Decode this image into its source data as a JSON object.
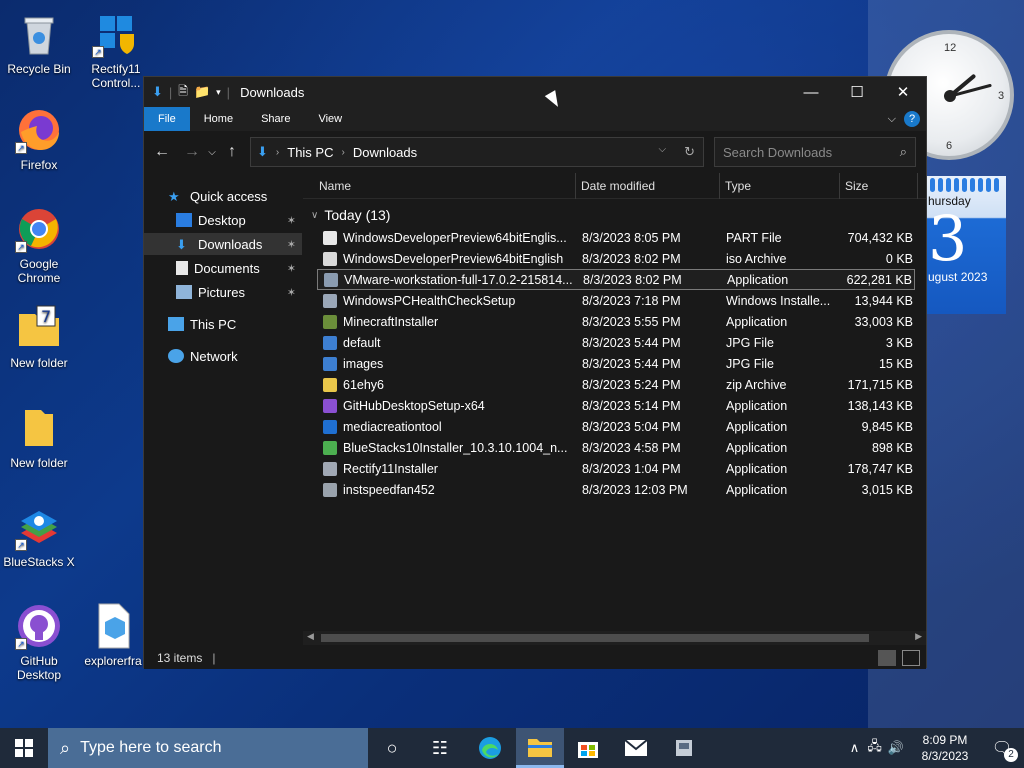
{
  "desktop": {
    "icons": [
      {
        "label": "Recycle Bin"
      },
      {
        "label": "Rectify11 Control..."
      },
      {
        "label": "Firefox"
      },
      {
        "label": "Google Chrome"
      },
      {
        "label": "New folder"
      },
      {
        "label": "New folder"
      },
      {
        "label": "BlueStacks X"
      },
      {
        "label": "GitHub Desktop"
      },
      {
        "label": "explorerfra"
      }
    ],
    "clock_numbers": [
      "12",
      "3",
      "6"
    ],
    "calendar": {
      "day_name": "hursday",
      "day_number": "3",
      "month": "ugust 2023"
    }
  },
  "window": {
    "title": "Downloads",
    "ribbon_tabs": [
      "File",
      "Home",
      "Share",
      "View"
    ],
    "help_label": "?",
    "address": {
      "root": "This PC",
      "current": "Downloads"
    },
    "search_placeholder": "Search Downloads",
    "nav": {
      "quick_access": "Quick access",
      "desktop": "Desktop",
      "downloads": "Downloads",
      "documents": "Documents",
      "pictures": "Pictures",
      "this_pc": "This PC",
      "network": "Network"
    },
    "columns": {
      "name": "Name",
      "date": "Date modified",
      "type": "Type",
      "size": "Size"
    },
    "group_label": "Today (13)",
    "files": [
      {
        "name": "WindowsDeveloperPreview64bitEnglis...",
        "date": "8/3/2023 8:05 PM",
        "type": "PART File",
        "size": "704,432 KB",
        "icon_color": "#e8e8e8"
      },
      {
        "name": "WindowsDeveloperPreview64bitEnglish",
        "date": "8/3/2023 8:02 PM",
        "type": "iso Archive",
        "size": "0 KB",
        "icon_color": "#d9d9d9"
      },
      {
        "name": "VMware-workstation-full-17.0.2-215814...",
        "date": "8/3/2023 8:02 PM",
        "type": "Application",
        "size": "622,281 KB",
        "icon_color": "#8a9bb0"
      },
      {
        "name": "WindowsPCHealthCheckSetup",
        "date": "8/3/2023 7:18 PM",
        "type": "Windows Installe...",
        "size": "13,944 KB",
        "icon_color": "#9aa7b8"
      },
      {
        "name": "MinecraftInstaller",
        "date": "8/3/2023 5:55 PM",
        "type": "Application",
        "size": "33,003 KB",
        "icon_color": "#6b8e3a"
      },
      {
        "name": "default",
        "date": "8/3/2023 5:44 PM",
        "type": "JPG File",
        "size": "3 KB",
        "icon_color": "#3d7fd1"
      },
      {
        "name": "images",
        "date": "8/3/2023 5:44 PM",
        "type": "JPG File",
        "size": "15 KB",
        "icon_color": "#3d7fd1"
      },
      {
        "name": "61ehy6",
        "date": "8/3/2023 5:24 PM",
        "type": "zip Archive",
        "size": "171,715 KB",
        "icon_color": "#e8c64a"
      },
      {
        "name": "GitHubDesktopSetup-x64",
        "date": "8/3/2023 5:14 PM",
        "type": "Application",
        "size": "138,143 KB",
        "icon_color": "#8a4fd1"
      },
      {
        "name": "mediacreationtool",
        "date": "8/3/2023 5:04 PM",
        "type": "Application",
        "size": "9,845 KB",
        "icon_color": "#1f6fd1"
      },
      {
        "name": "BlueStacks10Installer_10.3.10.1004_n...",
        "date": "8/3/2023 4:58 PM",
        "type": "Application",
        "size": "898 KB",
        "icon_color": "#4caf50"
      },
      {
        "name": "Rectify11Installer",
        "date": "8/3/2023 1:04 PM",
        "type": "Application",
        "size": "178,747 KB",
        "icon_color": "#a0a8b4"
      },
      {
        "name": "instspeedfan452",
        "date": "8/3/2023 12:03 PM",
        "type": "Application",
        "size": "3,015 KB",
        "icon_color": "#9aa3ad"
      }
    ],
    "status_text": "13 items"
  },
  "taskbar": {
    "search_placeholder": "Type here to search",
    "time": "8:09 PM",
    "date": "8/3/2023",
    "notification_count": "2"
  },
  "colors": {
    "accent": "#1979ca",
    "window_bg": "#191919",
    "taskbar_search": "#4a6d96"
  }
}
